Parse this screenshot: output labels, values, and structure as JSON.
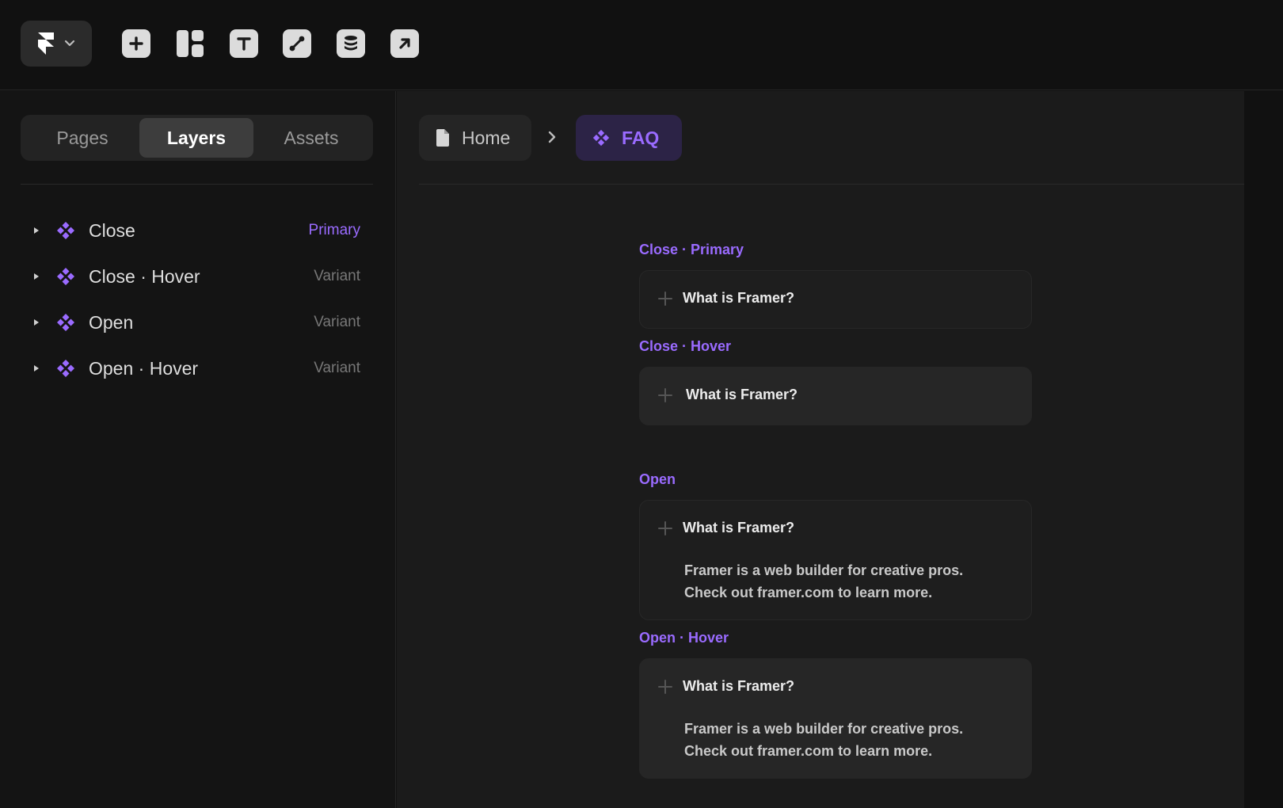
{
  "toolbar": {
    "logo": "framer-logo-icon",
    "tools": [
      "add-icon",
      "layout-icon",
      "text-icon",
      "vector-icon",
      "cms-icon",
      "open-external-icon"
    ]
  },
  "sidebar": {
    "tabs": [
      {
        "label": "Pages",
        "active": false
      },
      {
        "label": "Layers",
        "active": true
      },
      {
        "label": "Assets",
        "active": false
      }
    ],
    "layers": [
      {
        "name": "Close",
        "tag": "Primary"
      },
      {
        "name": "Close · Hover",
        "tag": "Variant"
      },
      {
        "name": "Open",
        "tag": "Variant"
      },
      {
        "name": "Open · Hover",
        "tag": "Variant"
      }
    ]
  },
  "breadcrumb": {
    "home": "Home",
    "current": "FAQ"
  },
  "canvas": {
    "variants": [
      {
        "label": "Close · Primary",
        "question": "What is Framer?",
        "answer": ""
      },
      {
        "label": "Close · Hover",
        "question": "What is Framer?",
        "answer": ""
      },
      {
        "label": "Open",
        "question": "What is Framer?",
        "answer_line1": "Framer is a web builder for creative pros.",
        "answer_line2": "Check out framer.com to learn more."
      },
      {
        "label": "Open · Hover",
        "question": "What is Framer?",
        "answer_line1": "Framer is a web builder for creative pros.",
        "answer_line2": "Check out framer.com to learn more."
      }
    ]
  },
  "colors": {
    "accent": "#9a6bff",
    "background": "#111111",
    "panel": "#141414",
    "canvas": "#1b1b1b"
  }
}
